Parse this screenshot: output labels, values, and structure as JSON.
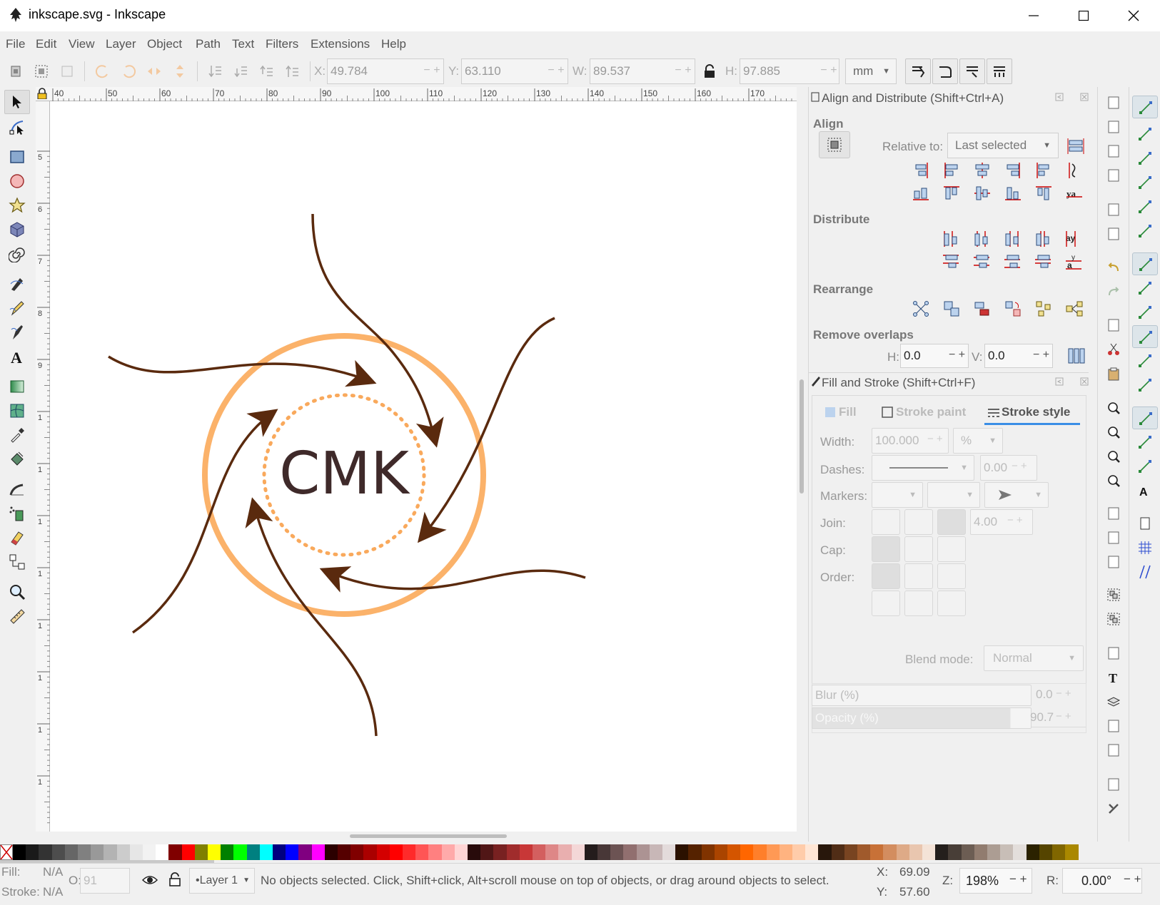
{
  "window": {
    "title": "inkscape.svg - Inkscape",
    "controls": [
      "minimize",
      "maximize",
      "close"
    ]
  },
  "menu": [
    "File",
    "Edit",
    "View",
    "Layer",
    "Object",
    "Path",
    "Text",
    "Filters",
    "Extensions",
    "Help"
  ],
  "toolbar": {
    "x_label": "X:",
    "x_value": "49.784",
    "y_label": "Y:",
    "y_value": "63.110",
    "w_label": "W:",
    "w_value": "89.537",
    "h_label": "H:",
    "h_value": "97.885",
    "unit": "mm"
  },
  "ruler": {
    "top": [
      "40",
      "50",
      "60",
      "70",
      "80",
      "90",
      "100",
      "110",
      "120",
      "130",
      "140",
      "150",
      "160",
      "170"
    ],
    "left": [
      "5",
      "6",
      "7",
      "8",
      "9",
      "1",
      "1",
      "1",
      "1",
      "1",
      "1",
      "1",
      "1"
    ]
  },
  "canvas": {
    "logo_text": "CMK",
    "colors": {
      "arrow": "#5a2a0e",
      "ring": "#fbb26a",
      "text": "#3f2a2a"
    }
  },
  "align_panel": {
    "title": "Align and Distribute (Shift+Ctrl+A)",
    "align_heading": "Align",
    "relative_label": "Relative to:",
    "relative_value": "Last selected",
    "distribute_heading": "Distribute",
    "rearrange_heading": "Rearrange",
    "remove_overlaps_heading": "Remove overlaps",
    "h_label": "H:",
    "h_value": "0.0",
    "v_label": "V:",
    "v_value": "0.0"
  },
  "fill_panel": {
    "title": "Fill and Stroke (Shift+Ctrl+F)",
    "tabs": [
      "Fill",
      "Stroke paint",
      "Stroke style"
    ],
    "active_tab": "Stroke style",
    "width_label": "Width:",
    "width_value": "100.000",
    "width_unit": "%",
    "dashes_label": "Dashes:",
    "dashes_value": "0.00",
    "markers_label": "Markers:",
    "join_label": "Join:",
    "miter_value": "4.00",
    "cap_label": "Cap:",
    "order_label": "Order:",
    "blend_label": "Blend mode:",
    "blend_value": "Normal",
    "blur_label": "Blur (%)",
    "blur_value": "0.0",
    "opacity_label": "Opacity (%)",
    "opacity_value": "90.7"
  },
  "palette": [
    "#000000",
    "#1a1a1a",
    "#333333",
    "#4d4d4d",
    "#666666",
    "#808080",
    "#999999",
    "#b3b3b3",
    "#cccccc",
    "#e6e6e6",
    "#f2f2f2",
    "#ffffff",
    "#800000",
    "#ff0000",
    "#808000",
    "#ffff00",
    "#008000",
    "#00ff00",
    "#008080",
    "#00ffff",
    "#000080",
    "#0000ff",
    "#800080",
    "#ff00ff",
    "#2b0000",
    "#550000",
    "#800000",
    "#aa0000",
    "#d40000",
    "#ff0000",
    "#ff2a2a",
    "#ff5555",
    "#ff8080",
    "#ffaaaa",
    "#ffd5d5",
    "#280b0b",
    "#501616",
    "#782121",
    "#a02c2c",
    "#c83737",
    "#d35f5f",
    "#de8787",
    "#e9afaf",
    "#f4d7d7",
    "#241c1c",
    "#483737",
    "#6c5353",
    "#916f6f",
    "#ac9393",
    "#c8b7b7",
    "#e3dbdb",
    "#2b1100",
    "#552200",
    "#803300",
    "#aa4400",
    "#d45500",
    "#ff6600",
    "#ff7f2a",
    "#ff9955",
    "#ffb380",
    "#ffccaa",
    "#ffe6d5",
    "#28170b",
    "#502d16",
    "#784421",
    "#a05a2c",
    "#c87137",
    "#d38d5f",
    "#deaa87",
    "#e9c6af",
    "#f4e3d7",
    "#241f1c",
    "#483e37",
    "#6c5d53",
    "#917c6f",
    "#ac9d93",
    "#c8beb7",
    "#e3dedb",
    "#2b2200",
    "#554400",
    "#806600",
    "#aa8800"
  ],
  "status": {
    "fill_label": "Fill:",
    "fill_value": "N/A",
    "stroke_label": "Stroke:",
    "stroke_value": "N/A",
    "opacity_label": "O:",
    "opacity_value": "91",
    "layer": "•Layer 1",
    "message": "No objects selected. Click, Shift+click, Alt+scroll mouse on top of objects, or drag around objects to select.",
    "x_label": "X:",
    "x_value": "69.09",
    "y_label": "Y:",
    "y_value": "57.60",
    "zoom_label": "Z:",
    "zoom_value": "198%",
    "rotate_label": "R:",
    "rotate_value": "0.00°"
  }
}
